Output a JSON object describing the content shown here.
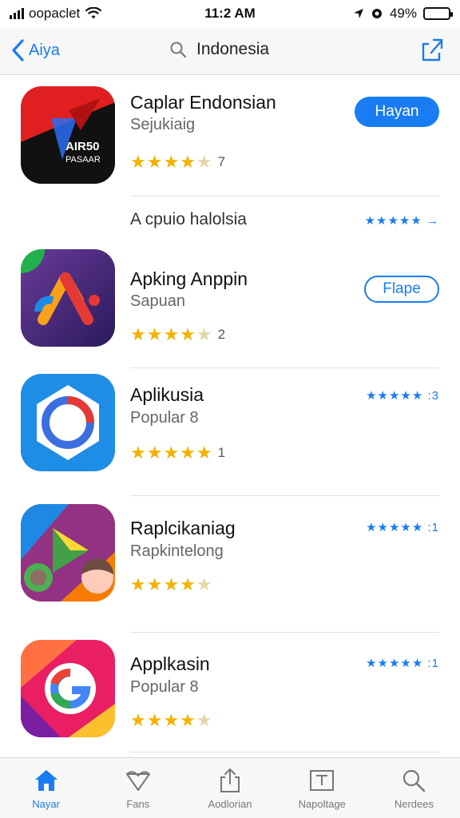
{
  "status_bar": {
    "carrier": "oopaclet",
    "time": "11:2 AM",
    "battery": "49%"
  },
  "nav": {
    "back_label": "Aiya",
    "search_text": "Indonesia"
  },
  "apps": [
    {
      "title": "Caplar Endonsian",
      "subtitle": "Sejukiaig",
      "rating_count": "7",
      "button_label": "Hayan",
      "icon_text_1": "AIR50",
      "icon_text_2": "PASAAR"
    },
    {
      "title": "Apking Anppin",
      "subtitle": "Sapuan",
      "rating_count": "2",
      "button_label": "Flape"
    },
    {
      "title": "Aplikusia",
      "subtitle": "Popular 8",
      "rating_count": "1",
      "side_rating": "★★★★★ :3"
    },
    {
      "title": "Raplcikaniag",
      "subtitle": "Rapkintelong",
      "side_rating": "★★★★★ :1"
    },
    {
      "title": "Applkasin",
      "subtitle": "Popular 8",
      "side_rating": "★★★★★ :1"
    }
  ],
  "section": {
    "label": "A cpuio halolsia",
    "side_rating": "★★★★★ →"
  },
  "tabs": [
    {
      "label": "Nayar",
      "icon": "home-icon"
    },
    {
      "label": "Fans",
      "icon": "heart-icon"
    },
    {
      "label": "Aodlorian",
      "icon": "share-icon"
    },
    {
      "label": "Napoltage",
      "icon": "picture-icon"
    },
    {
      "label": "Nerdees",
      "icon": "search-icon"
    }
  ],
  "colors": {
    "accent": "#1a7cf2",
    "star": "#f5b100"
  }
}
